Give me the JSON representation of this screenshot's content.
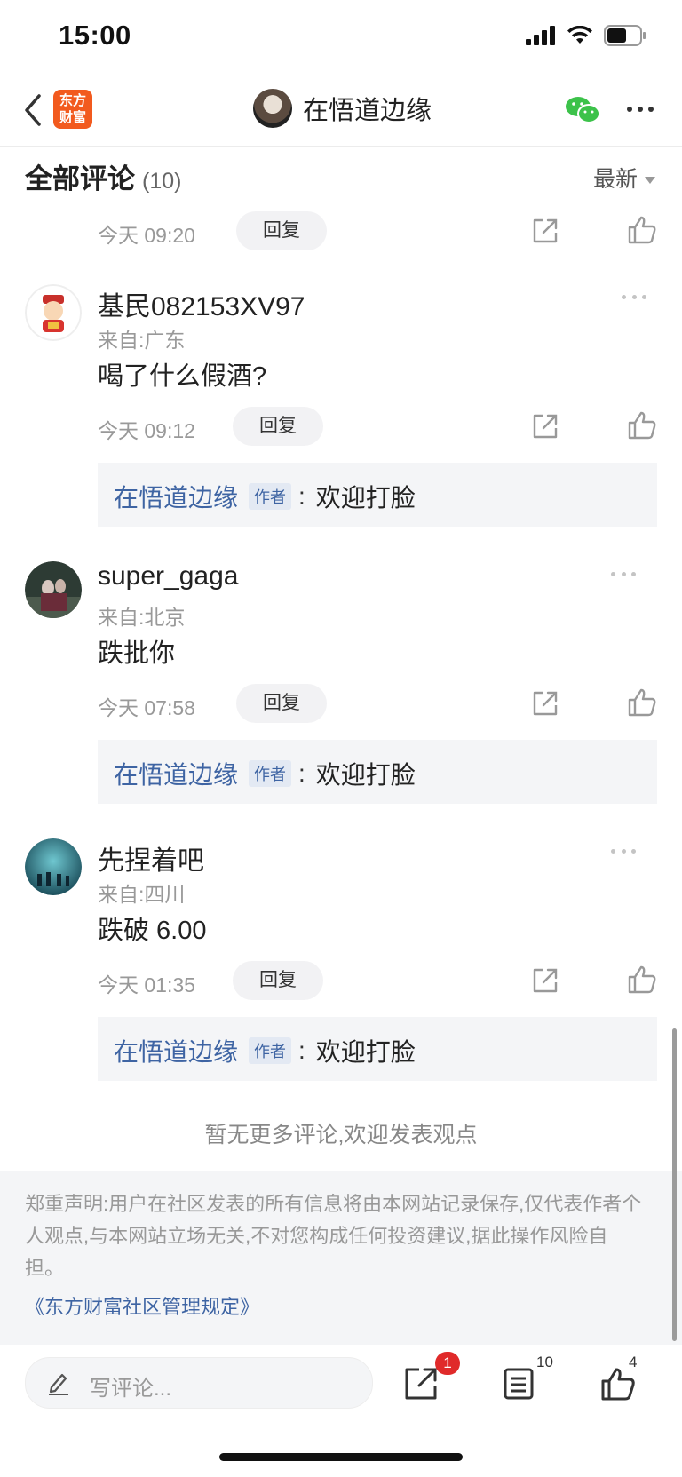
{
  "status": {
    "time": "15:00"
  },
  "nav": {
    "back_icon": "chevron-left-icon",
    "logo_text": [
      "东方",
      "财富"
    ],
    "title": "在悟道边缘",
    "wechat_icon": "wechat-icon",
    "more_icon": "more-icon"
  },
  "comments_header": {
    "title": "全部评论",
    "count": "(10)",
    "sort": "最新"
  },
  "partial_actions": {
    "time": "今天 09:20",
    "reply": "回复"
  },
  "comments": [
    {
      "user": "基民082153XV97",
      "location": "来自:广东",
      "content": "喝了什么假酒?",
      "time": "今天 09:12",
      "reply_label": "回复",
      "author_reply": {
        "name": "在悟道边缘",
        "badge": "作者",
        "colon": ":",
        "text": "欢迎打脸"
      }
    },
    {
      "user": "super_gaga",
      "location": "来自:北京",
      "content": "跌批你",
      "time": "今天 07:58",
      "reply_label": "回复",
      "author_reply": {
        "name": "在悟道边缘",
        "badge": "作者",
        "colon": ":",
        "text": "欢迎打脸"
      }
    },
    {
      "user": "先捏着吧",
      "location": "来自:四川",
      "content": "跌破 6.00",
      "time": "今天 01:35",
      "reply_label": "回复",
      "author_reply": {
        "name": "在悟道边缘",
        "badge": "作者",
        "colon": ":",
        "text": "欢迎打脸"
      }
    }
  ],
  "no_more_text": "暂无更多评论,欢迎发表观点",
  "disclaimer": {
    "text": "郑重声明:用户在社区发表的所有信息将由本网站记录保存,仅代表作者个人观点,与本网站立场无关,不对您构成任何投资建议,据此操作风险自担。",
    "link": "《东方财富社区管理规定》"
  },
  "bottom_bar": {
    "placeholder": "写评论...",
    "share_badge": "1",
    "comments_count": "10",
    "likes_count": "4"
  },
  "colors": {
    "accent_blue": "#3e64a3",
    "logo_orange": "#f25a1e",
    "badge_red": "#e02a2a",
    "wechat_green": "#3cc24a"
  }
}
